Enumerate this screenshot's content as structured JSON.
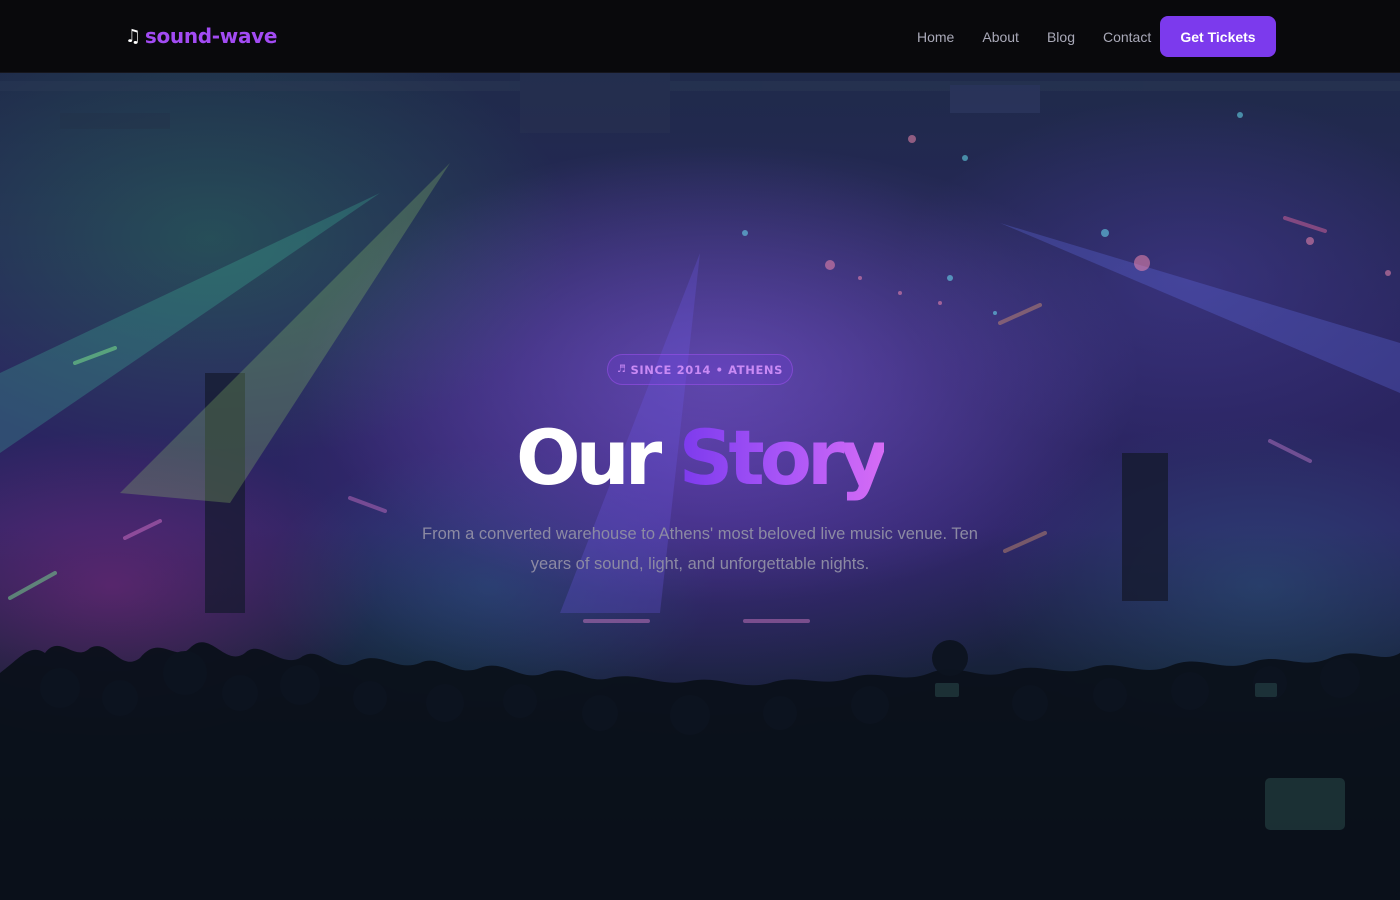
{
  "nav": {
    "brand_icon": "♫",
    "brand_name": "sound-wave",
    "links": [
      "Home",
      "About",
      "Blog",
      "Contact"
    ],
    "cta_label": "Get Tickets"
  },
  "hero": {
    "badge_icon": "♬",
    "badge_text": "SINCE 2014 • ATHENS",
    "title_white": "Our ",
    "title_accent": "Story",
    "subtitle": "From a converted warehouse to Athens' most beloved live music venue. Ten years of sound, light, and unforgettable nights.",
    "background_image": "concert-crowd-image"
  },
  "colors": {
    "accent": "#7c3aed",
    "accent_light": "#a855f7",
    "nav_bg": "#09090c",
    "nav_text": "#a9a9b8",
    "subtitle_text": "#8c8aa3"
  }
}
